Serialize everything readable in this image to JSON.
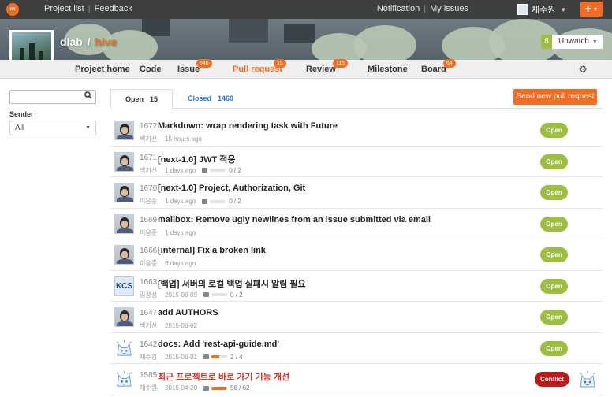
{
  "topbar": {
    "logo": "hive-logo-icon",
    "nav": [
      "Project list",
      "Feedback"
    ],
    "right_links": [
      "Notification",
      "My issues"
    ],
    "user_name": "채수원",
    "plus_label": "+"
  },
  "project": {
    "owner": "dlab",
    "separator": "/",
    "name": "hive",
    "watch_count": "8",
    "watch_label": "Unwatch"
  },
  "tabs": [
    {
      "label": "Project home"
    },
    {
      "label": "Code"
    },
    {
      "label": "Issue",
      "badge": "646"
    },
    {
      "label": "Pull request",
      "badge": "15",
      "active": true
    },
    {
      "label": "Review",
      "badge": "115"
    },
    {
      "label": "Milestone"
    },
    {
      "label": "Board",
      "badge": "64"
    }
  ],
  "filter": {
    "search_value": "",
    "sender_label": "Sender",
    "sender_value": "All"
  },
  "state_tabs": {
    "open_label": "Open",
    "open_count": "15",
    "closed_label": "Closed",
    "closed_count": "1460"
  },
  "new_pr_label": "Send new pull request",
  "pull_requests": [
    {
      "number": "1672",
      "title": "Markdown: wrap rendering task with Future",
      "author": "백기선",
      "time": "15 hours ago",
      "comments": null,
      "status": "Open",
      "avatar": "photo"
    },
    {
      "number": "1671",
      "title": "[next-1.0] JWT 적용",
      "author": "백기선",
      "time": "1 days ago",
      "comments": "0 / 2",
      "progress": 0,
      "status": "Open",
      "avatar": "photo"
    },
    {
      "number": "1670",
      "title": "[next-1.0] Project, Authorization, Git",
      "author": "이응준",
      "time": "1 days ago",
      "comments": "0 / 2",
      "progress": 0,
      "status": "Open",
      "avatar": "photo"
    },
    {
      "number": "1669",
      "title": "mailbox: Remove ugly newlines from an issue submitted via email",
      "author": "이응준",
      "time": "1 days ago",
      "comments": null,
      "status": "Open",
      "avatar": "photo"
    },
    {
      "number": "1666",
      "title": "[internal] Fix a broken link",
      "author": "이응준",
      "time": "6 days ago",
      "comments": null,
      "status": "Open",
      "avatar": "photo"
    },
    {
      "number": "1663",
      "title": "[백업] 서버의 로컬 백업 실패시 알림 필요",
      "author": "김창성",
      "time": "2015-06-09",
      "comments": "0 / 2",
      "progress": 0,
      "status": "Open",
      "avatar": "kcs",
      "avatar_text": "KCS"
    },
    {
      "number": "1647",
      "title": "add AUTHORS",
      "author": "백기선",
      "time": "2015-06-02",
      "comments": null,
      "status": "Open",
      "avatar": "photo"
    },
    {
      "number": "1642",
      "title": "docs: Add 'rest-api-guide.md'",
      "author": "채수원",
      "time": "2015-06-01",
      "comments": "2 / 4",
      "progress": 0.5,
      "status": "Open",
      "avatar": "cat"
    },
    {
      "number": "1585",
      "title": "최근 프로젝트로 바로 가기 기능 개선",
      "author": "채수원",
      "time": "2015-04-20",
      "comments": "58 / 62",
      "progress": 0.94,
      "status": "Conflict",
      "avatar": "cat",
      "title_color": "#d0342c",
      "reviewer": "cat"
    }
  ],
  "colors": {
    "accent": "#f36c21",
    "open": "#9dbf3f",
    "conflict": "#b71c1c",
    "link": "#2e7abf"
  }
}
